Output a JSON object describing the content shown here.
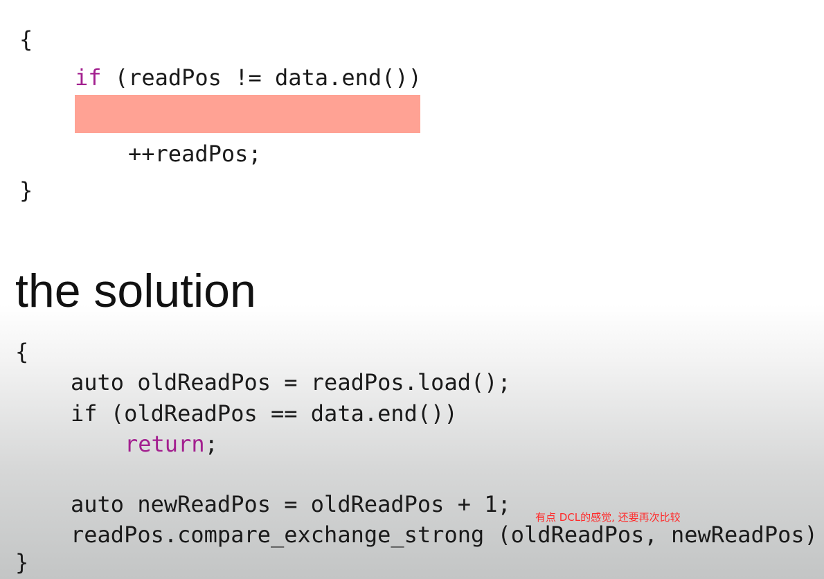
{
  "problem_code": {
    "open_brace": "{",
    "if_keyword": "if",
    "if_rest": " (readPos != data.end())",
    "increment": "++readPos;",
    "close_brace": "}"
  },
  "heading": "the solution",
  "solution_code": {
    "open_brace": "{",
    "line1": "auto oldReadPos = readPos.load();",
    "line2": "if (oldReadPos == data.end())",
    "return_keyword": "return",
    "return_semicolon": ";",
    "line4": "auto newReadPos = oldReadPos + 1;",
    "line5": "readPos.compare_exchange_strong (oldReadPos, newReadPos)",
    "close_brace": "}"
  },
  "annotation": "有点 DCL的感觉, 还要再次比较",
  "colors": {
    "keyword": "#a3208f",
    "highlight": "#ffa294",
    "annotation": "#ff2a2a"
  }
}
